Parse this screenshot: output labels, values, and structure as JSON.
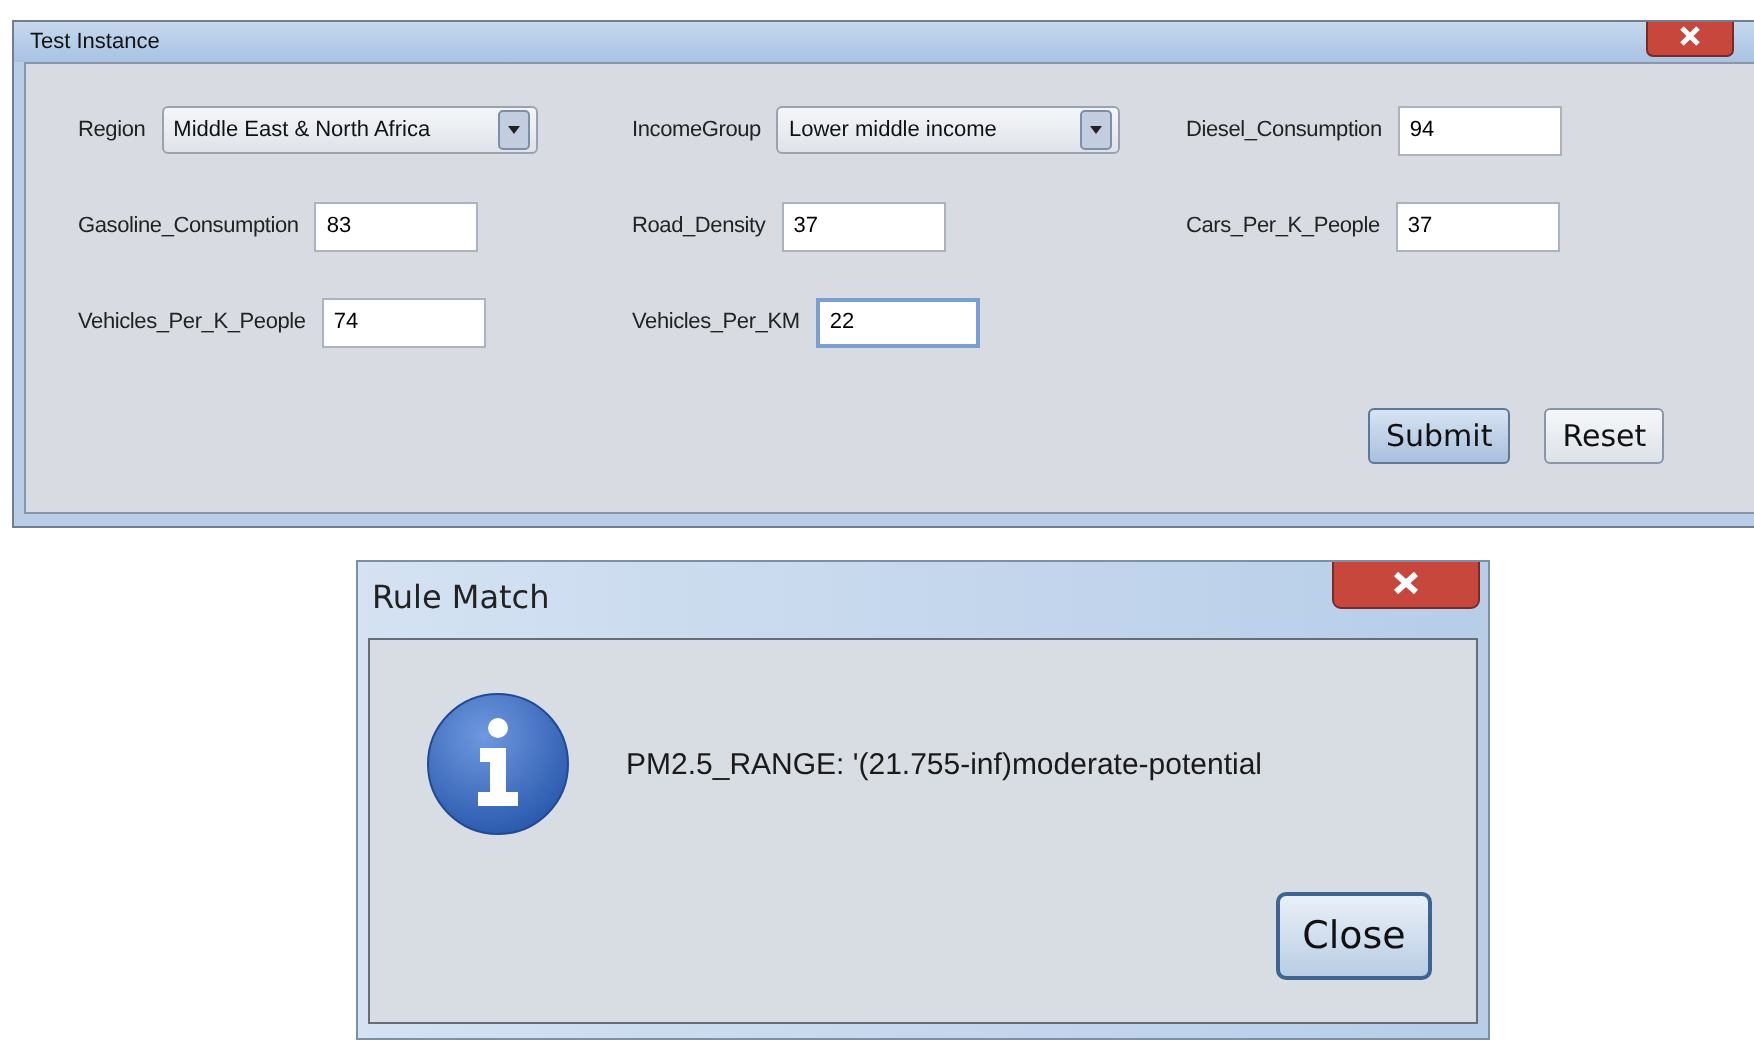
{
  "main_window": {
    "title": "Test Instance",
    "fields": [
      {
        "kind": "dropdown",
        "label": "Region",
        "value": "Middle East & North Africa",
        "focused": false
      },
      {
        "kind": "dropdown",
        "label": "IncomeGroup",
        "value": "Lower middle income",
        "focused": false
      },
      {
        "kind": "text",
        "label": "Diesel_Consumption",
        "value": "94",
        "focused": false
      },
      {
        "kind": "text",
        "label": "Gasoline_Consumption",
        "value": "83",
        "focused": false
      },
      {
        "kind": "text",
        "label": "Road_Density",
        "value": "37",
        "focused": false
      },
      {
        "kind": "text",
        "label": "Cars_Per_K_People",
        "value": "37",
        "focused": false
      },
      {
        "kind": "text",
        "label": "Vehicles_Per_K_People",
        "value": "74",
        "focused": false
      },
      {
        "kind": "text",
        "label": "Vehicles_Per_KM",
        "value": "22",
        "focused": true
      }
    ],
    "buttons": [
      {
        "label": "Submit",
        "default": true
      },
      {
        "label": "Reset",
        "default": false
      }
    ]
  },
  "dialog": {
    "title": "Rule Match",
    "message": "PM2.5_RANGE: '(21.755-inf)moderate-potential",
    "button": "Close"
  }
}
